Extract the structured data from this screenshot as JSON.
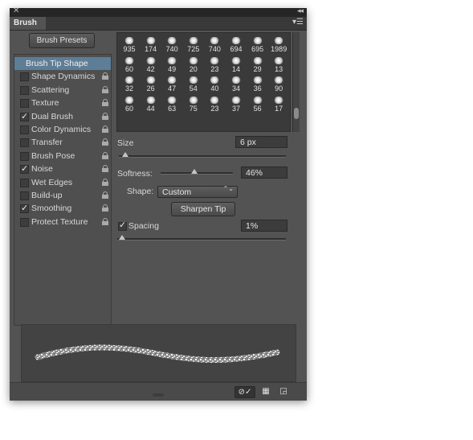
{
  "panel": {
    "close_glyph": "✕",
    "collapse_glyph": "◂◂",
    "tab_label": "Brush",
    "menu_glyph": "▾☰",
    "colors": {
      "panel_bg": "#535353",
      "selected_row": "#5e7d96"
    }
  },
  "presets_button": {
    "label": "Brush Presets"
  },
  "options": [
    {
      "label": "Brush Tip Shape",
      "selected": true,
      "has_checkbox": false,
      "checked": false,
      "lock": false
    },
    {
      "label": "Shape Dynamics",
      "selected": false,
      "has_checkbox": true,
      "checked": false,
      "lock": true
    },
    {
      "label": "Scattering",
      "selected": false,
      "has_checkbox": true,
      "checked": false,
      "lock": true
    },
    {
      "label": "Texture",
      "selected": false,
      "has_checkbox": true,
      "checked": false,
      "lock": true
    },
    {
      "label": "Dual Brush",
      "selected": false,
      "has_checkbox": true,
      "checked": true,
      "lock": true
    },
    {
      "label": "Color Dynamics",
      "selected": false,
      "has_checkbox": true,
      "checked": false,
      "lock": true
    },
    {
      "label": "Transfer",
      "selected": false,
      "has_checkbox": true,
      "checked": false,
      "lock": true
    },
    {
      "label": "Brush Pose",
      "selected": false,
      "has_checkbox": true,
      "checked": false,
      "lock": true
    },
    {
      "label": "Noise",
      "selected": false,
      "has_checkbox": true,
      "checked": true,
      "lock": true
    },
    {
      "label": "Wet Edges",
      "selected": false,
      "has_checkbox": true,
      "checked": false,
      "lock": true
    },
    {
      "label": "Build-up",
      "selected": false,
      "has_checkbox": true,
      "checked": false,
      "lock": true
    },
    {
      "label": "Smoothing",
      "selected": false,
      "has_checkbox": true,
      "checked": true,
      "lock": true
    },
    {
      "label": "Protect Texture",
      "selected": false,
      "has_checkbox": true,
      "checked": false,
      "lock": true
    }
  ],
  "brush_tips": [
    "935",
    "174",
    "740",
    "725",
    "740",
    "694",
    "695",
    "1989",
    "60",
    "42",
    "49",
    "20",
    "23",
    "14",
    "29",
    "13",
    "32",
    "26",
    "47",
    "54",
    "40",
    "34",
    "36",
    "90",
    "60",
    "44",
    "63",
    "75",
    "23",
    "37",
    "56",
    "17"
  ],
  "size": {
    "label": "Size",
    "value": "6 px",
    "level": 0.02
  },
  "softness": {
    "label": "Softness:",
    "value": "46%",
    "level": 0.46
  },
  "shape": {
    "label": "Shape:",
    "selected": "Custom",
    "arrows": "⌃⌄"
  },
  "sharpen_button": {
    "label": "Sharpen Tip"
  },
  "spacing": {
    "label": "Spacing",
    "checked": true,
    "value": "1%",
    "level": 0.01
  },
  "bottom_icons": [
    {
      "name": "toggle-preview-icon",
      "glyph": "⊘✓",
      "active": true
    },
    {
      "name": "create-from-preview-icon",
      "glyph": "▦",
      "active": false
    },
    {
      "name": "new-brush-icon",
      "glyph": "◲",
      "active": false
    }
  ]
}
